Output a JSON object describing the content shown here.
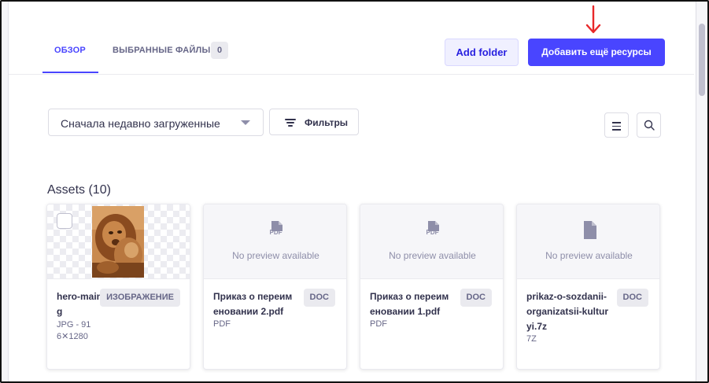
{
  "header": {
    "tabs": [
      {
        "label": "ОБЗОР",
        "active": true
      },
      {
        "label": "ВЫБРАННЫЕ ФАЙЛЫ",
        "count": "0",
        "active": false
      }
    ],
    "add_folder_label": "Add folder",
    "add_more_label": "Добавить ещё ресурсы"
  },
  "toolbar": {
    "sort_value": "Сначала недавно загруженные",
    "filters_label": "Фильтры"
  },
  "assets": {
    "title": "Assets (10)",
    "cards": [
      {
        "name": "hero-main-page.jpg",
        "badge": "ИЗОБРАЖЕНИЕ",
        "meta_1": "JPG - 91",
        "meta_2": "6✕1280"
      },
      {
        "name": "Приказ о переименовании 2.pdf",
        "badge": "DOC",
        "type": "PDF",
        "preview_text": "No preview available",
        "icon_label": "PDF"
      },
      {
        "name": "Приказ о переименовании 1.pdf",
        "badge": "DOC",
        "type": "PDF",
        "preview_text": "No preview available",
        "icon_label": "PDF"
      },
      {
        "name": "prikaz-o-sozdanii-organizatsii-kulturyi.7z",
        "badge": "DOC",
        "type": "7Z",
        "preview_text": "No preview available"
      }
    ]
  },
  "colors": {
    "primary": "#4945ff",
    "annotation_arrow": "#e8282a",
    "text_dark": "#32324d",
    "text_muted": "#666687"
  },
  "icons": [
    "arrow-down-icon",
    "filter-icon",
    "list-view-icon",
    "search-icon",
    "pdf-file-icon",
    "file-icon"
  ]
}
